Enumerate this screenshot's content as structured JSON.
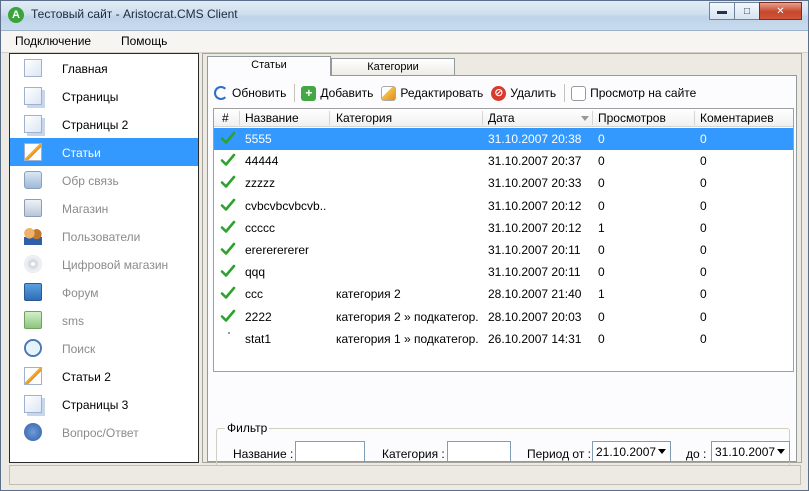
{
  "window": {
    "title": "Тестовый сайт - Aristocrat.CMS Client",
    "app_icon": "A"
  },
  "menu": [
    "Подключение",
    "Помощь"
  ],
  "sidebar": {
    "items": [
      {
        "label": "Главная",
        "icon": "document-icon",
        "disabled": false
      },
      {
        "label": "Страницы",
        "icon": "pages-icon",
        "disabled": false
      },
      {
        "label": "Страницы 2",
        "icon": "pages-icon",
        "disabled": false
      },
      {
        "label": "Статьи",
        "icon": "pencil-doc-icon",
        "disabled": false,
        "selected": true
      },
      {
        "label": "Обр связь",
        "icon": "feedback-icon",
        "disabled": true
      },
      {
        "label": "Магазин",
        "icon": "shop-bag-icon",
        "disabled": true
      },
      {
        "label": "Пользователи",
        "icon": "users-icon",
        "disabled": true
      },
      {
        "label": "Цифровой магазин",
        "icon": "cd-icon",
        "disabled": true
      },
      {
        "label": "Форум",
        "icon": "forum-icon",
        "disabled": true
      },
      {
        "label": "sms",
        "icon": "phone-icon",
        "disabled": true
      },
      {
        "label": "Поиск",
        "icon": "magnifier-icon",
        "disabled": true
      },
      {
        "label": "Статьи 2",
        "icon": "pencil-doc-icon",
        "disabled": false
      },
      {
        "label": "Страницы 3",
        "icon": "pages-icon",
        "disabled": false
      },
      {
        "label": "Вопрос/Ответ",
        "icon": "help-icon",
        "disabled": true
      }
    ]
  },
  "tabs": [
    "Статьи",
    "Категории"
  ],
  "toolbar": {
    "refresh": "Обновить",
    "add": "Добавить",
    "edit": "Редактировать",
    "delete": "Удалить",
    "preview": "Просмотр на сайте"
  },
  "grid": {
    "columns": [
      "#",
      "Название",
      "Категория",
      "Дата",
      "Просмотров",
      "Коментариев"
    ],
    "rows": [
      {
        "published": true,
        "name": "5555",
        "category": "",
        "date": "31.10.2007 20:38",
        "views": "0",
        "comments": "0"
      },
      {
        "published": true,
        "name": "44444",
        "category": "",
        "date": "31.10.2007 20:37",
        "views": "0",
        "comments": "0"
      },
      {
        "published": true,
        "name": "zzzzz",
        "category": "",
        "date": "31.10.2007 20:33",
        "views": "0",
        "comments": "0"
      },
      {
        "published": true,
        "name": "cvbcvbcvbcvb...",
        "category": "",
        "date": "31.10.2007 20:12",
        "views": "0",
        "comments": "0"
      },
      {
        "published": true,
        "name": "ccccc",
        "category": "",
        "date": "31.10.2007 20:12",
        "views": "1",
        "comments": "0"
      },
      {
        "published": true,
        "name": "erererererer",
        "category": "",
        "date": "31.10.2007 20:11",
        "views": "0",
        "comments": "0"
      },
      {
        "published": true,
        "name": "qqq",
        "category": "",
        "date": "31.10.2007 20:11",
        "views": "0",
        "comments": "0"
      },
      {
        "published": true,
        "name": "ccc",
        "category": "категория 2",
        "date": "28.10.2007 21:40",
        "views": "1",
        "comments": "0"
      },
      {
        "published": true,
        "name": "2222",
        "category": "категория 2 » подкатегор...",
        "date": "28.10.2007 20:03",
        "views": "0",
        "comments": "0"
      },
      {
        "published": false,
        "name": "stat1",
        "category": "категория 1 » подкатегор...",
        "date": "26.10.2007 14:31",
        "views": "0",
        "comments": "0"
      }
    ]
  },
  "filter": {
    "legend": "Фильтр",
    "name_label": "Название :",
    "category_label": "Категория :",
    "period_label": "Период от :",
    "to_label": "до :",
    "date_from": "21.10.2007",
    "date_to": "31.10.2007"
  },
  "colors": {
    "selection": "#3399ff",
    "check": "#2fa12f"
  }
}
